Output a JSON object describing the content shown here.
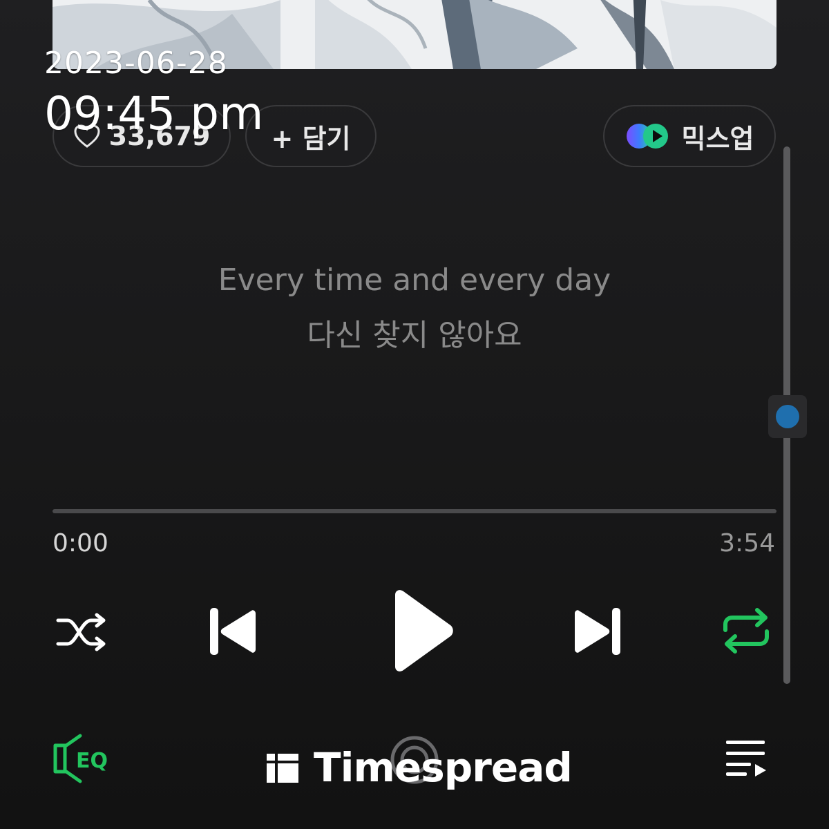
{
  "overlay": {
    "date": "2023-06-28",
    "time": "09:45 pm"
  },
  "actions": {
    "like_count": "33,679",
    "add_label": "+ 담기",
    "mixup_label": "믹스업"
  },
  "lyrics": {
    "line1": "Every time and every day",
    "line2": "다신 찾지 않아요"
  },
  "player": {
    "current_time": "0:00",
    "total_time": "3:54",
    "progress_fraction": 0.0
  },
  "icons": {
    "shuffle": "shuffle-icon",
    "previous": "skip-previous-icon",
    "play": "play-icon",
    "next": "skip-next-icon",
    "repeat": "repeat-icon",
    "eq": "equalizer-icon",
    "cast": "cast-icon",
    "queue": "playlist-icon",
    "like": "heart-icon",
    "mixup": "mixup-icon"
  },
  "colors": {
    "accent_green": "#22c55e",
    "scroll_knob": "#1f6fae"
  },
  "watermark": {
    "text": "Timespread"
  }
}
